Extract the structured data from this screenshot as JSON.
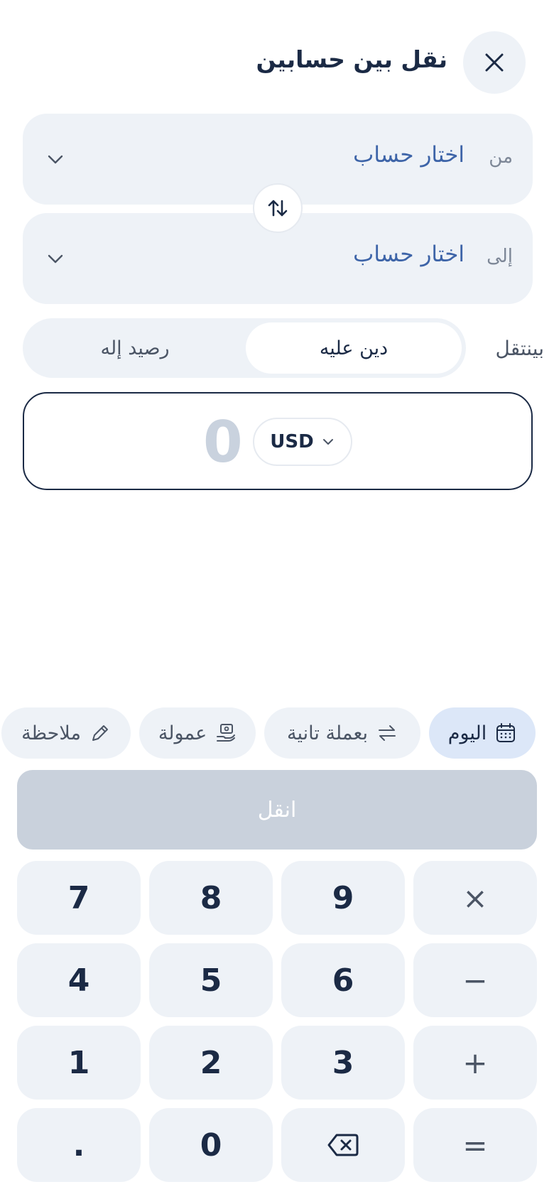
{
  "header": {
    "title": "نقل بين حسابين"
  },
  "from": {
    "label": "من",
    "placeholder": "اختار حساب"
  },
  "to": {
    "label": "إلى",
    "placeholder": "اختار حساب"
  },
  "direction": {
    "label": "بينتقل",
    "options": [
      "دين عليه",
      "رصيد إله"
    ],
    "selected": "دين عليه"
  },
  "amount": {
    "value": "0",
    "currency": "USD"
  },
  "chips": {
    "today": "اليوم",
    "other_currency": "بعملة تانية",
    "fee": "عمولة",
    "note": "ملاحظة"
  },
  "submit_label": "انقل",
  "keypad": {
    "row1": [
      "7",
      "8",
      "9",
      "×"
    ],
    "row2": [
      "4",
      "5",
      "6",
      "−"
    ],
    "row3": [
      "1",
      "2",
      "3",
      "+"
    ],
    "row4": [
      ".",
      "0",
      "",
      "="
    ]
  },
  "colors": {
    "accent": "#3d64a8",
    "text_dark": "#1b2a45",
    "surface": "#eef2f7",
    "chip_active": "#dce7f8",
    "button_disabled": "#c9d1dc"
  }
}
